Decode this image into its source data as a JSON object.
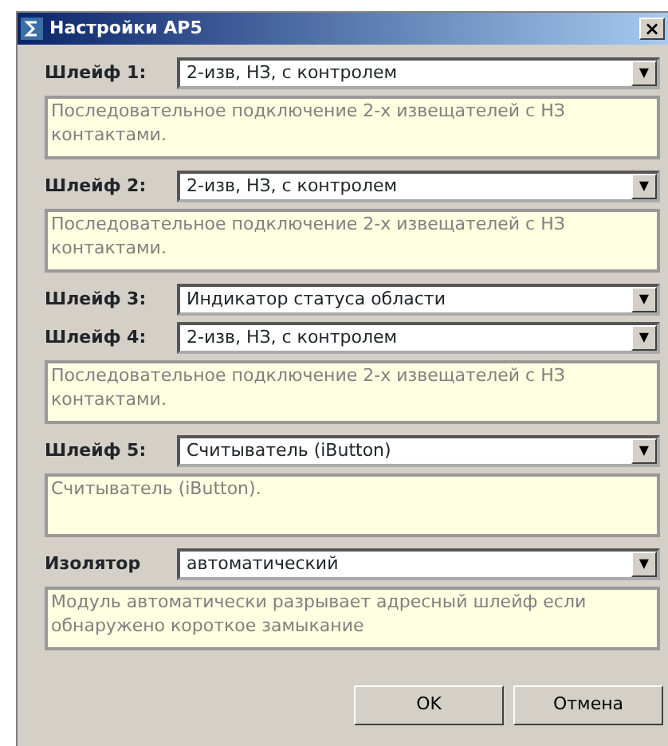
{
  "window": {
    "title": "Настройки АР5",
    "close": "×"
  },
  "settings": [
    {
      "label": "Шлейф 1:",
      "value": "2-изв, НЗ, с контролем",
      "arrow": "▼",
      "description": "Последовательное подключение 2-х извещателей с НЗ контактами."
    },
    {
      "label": "Шлейф 2:",
      "value": "2-изв, НЗ, с контролем",
      "arrow": "▼",
      "description": "Последовательное подключение 2-х извещателей с НЗ контактами."
    },
    {
      "label": "Шлейф 3:",
      "value": "Индикатор статуса области",
      "arrow": "▼"
    },
    {
      "label": "Шлейф 4:",
      "value": "2-изв, НЗ, с контролем",
      "arrow": "▼",
      "description": "Последовательное подключение 2-х извещателей с НЗ контактами."
    },
    {
      "label": "Шлейф 5:",
      "value": "Считыватель (iButton)",
      "arrow": "▼",
      "description": "Считыватель (iButton)."
    },
    {
      "label": "Изолятор",
      "value": "автоматический",
      "arrow": "▼",
      "description": "Модуль автоматически разрывает адресный шлейф если обнаружено короткое замыкание"
    }
  ],
  "buttons": [
    "OK",
    "Отмена"
  ]
}
